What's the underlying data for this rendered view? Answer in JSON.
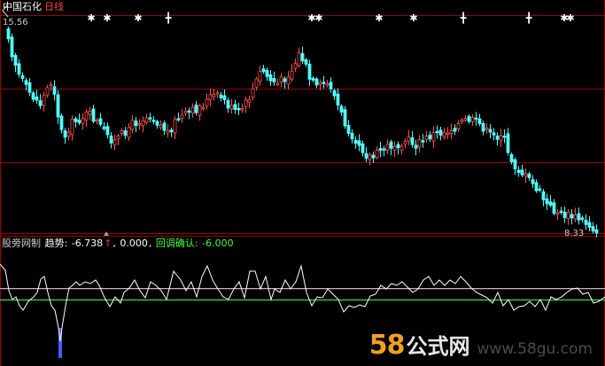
{
  "title": {
    "stock_name": "中国石化",
    "period": "日线"
  },
  "price_labels": {
    "high": "15.56",
    "low": "8.33"
  },
  "indicator": {
    "name": "股旁网制",
    "trend_label": "趋势:",
    "trend_value": "-6.738",
    "trend_arrow": "↑",
    "value2": "0.000",
    "confirm_label": "回调确认:",
    "confirm_value": "-6.000"
  },
  "watermark": {
    "number": "58",
    "name": "公式网",
    "url": "www.58gu.com"
  },
  "colors": {
    "background": "#000000",
    "rise": "#ff5050",
    "fall": "#50ffff",
    "grid": "#9a0000",
    "title_white": "#ffffff",
    "period_red": "#ff4040",
    "indicator_name": "#c8c8c8",
    "trend_value": "#ffffff",
    "arrow": "#ff3030",
    "confirm_green": "#40ff40",
    "cyan_ref": "#60e0e0",
    "green_ref": "#40ff40",
    "indicator_line": "#ffffff",
    "spike_blue": "#4060ff"
  },
  "icons": {
    "signal_star": "star-icon",
    "signal_cross": "cross-icon",
    "back_arrow": "back-arrow-icon",
    "period_marker": "triangle-up-icon"
  }
}
